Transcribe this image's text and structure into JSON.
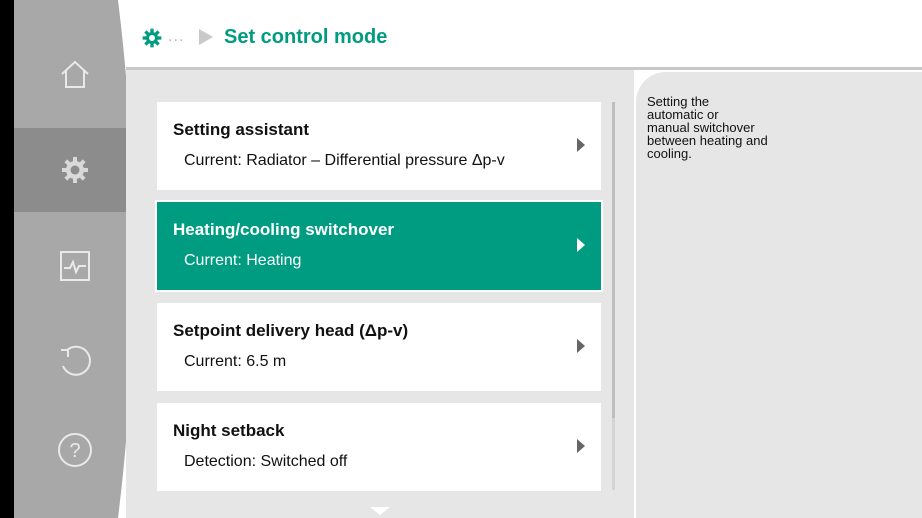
{
  "header": {
    "title": "Set control mode",
    "breadcrumb_dots": "..."
  },
  "nav": {
    "items": [
      {
        "name": "home",
        "icon": "home-icon"
      },
      {
        "name": "settings",
        "icon": "gear-icon",
        "active": true
      },
      {
        "name": "diagnostics",
        "icon": "pulse-icon"
      },
      {
        "name": "restore",
        "icon": "undo-icon"
      },
      {
        "name": "help",
        "icon": "question-icon"
      }
    ]
  },
  "menu": {
    "items": [
      {
        "title": "Setting assistant",
        "sub": "Current: Radiator – Differential pressure Δp-v"
      },
      {
        "title": "Heating/cooling switchover",
        "sub": "Current: Heating",
        "selected": true
      },
      {
        "title": "Setpoint delivery head (Δp-v)",
        "sub": "Current: 6.5 m"
      },
      {
        "title": "Night setback",
        "sub": "Detection: Switched off"
      }
    ]
  },
  "help": {
    "text": "Setting the\nautomatic or\nmanual switchover\nbetween heating and\ncooling."
  },
  "colors": {
    "accent": "#009c82",
    "panel": "#e6e6e6",
    "nav": "#a8a8a8",
    "nav_active": "#8c8c8c"
  }
}
